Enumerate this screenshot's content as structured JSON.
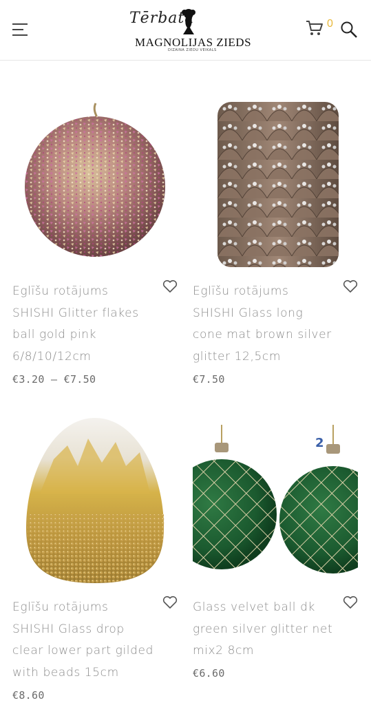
{
  "header": {
    "logo_script": "Tērbata",
    "logo_main": "MAGNOLIJAS ZIEDS",
    "logo_sub": "DIZAINA ZIEDU VEIKALS",
    "cart_count": "0",
    "icons": [
      "menu-icon",
      "cart-icon",
      "search-icon"
    ]
  },
  "products": [
    {
      "title": "Eglīšu rotājums SHISHI Glitter flakes ball gold pink 6/8/10/12cm",
      "title_lines": [
        "Eglīšu rotājums",
        "SHISHI Glitter flakes",
        "ball gold pink",
        "6/8/10/12cm"
      ],
      "price": "€3.20 – €7.50"
    },
    {
      "title": "Eglīšu rotājums SHISHI Glass long cone mat brown silver glitter 12,5cm",
      "title_lines": [
        "Eglīšu rotājums",
        "SHISHI Glass long",
        "cone mat brown silver",
        "glitter 12,5cm"
      ],
      "price": "€7.50"
    },
    {
      "title": "Eglīšu rotājums SHISHI Glass drop clear lower part gilded with beads 15cm",
      "title_lines": [
        "Eglīšu rotājums",
        "SHISHI Glass drop",
        "clear lower part gilded",
        "with beads 15cm"
      ],
      "price": "€8.60"
    },
    {
      "title": "Glass velvet ball dk green silver glitter net mix2 8cm",
      "title_lines": [
        "Glass velvet ball dk",
        "green silver glitter net",
        "mix2 8cm"
      ],
      "price": "€6.60",
      "image_badge": "2"
    }
  ],
  "colors": {
    "accent": "#e8b83a",
    "text": "#8c8c8c",
    "price": "#6b6b6b"
  }
}
